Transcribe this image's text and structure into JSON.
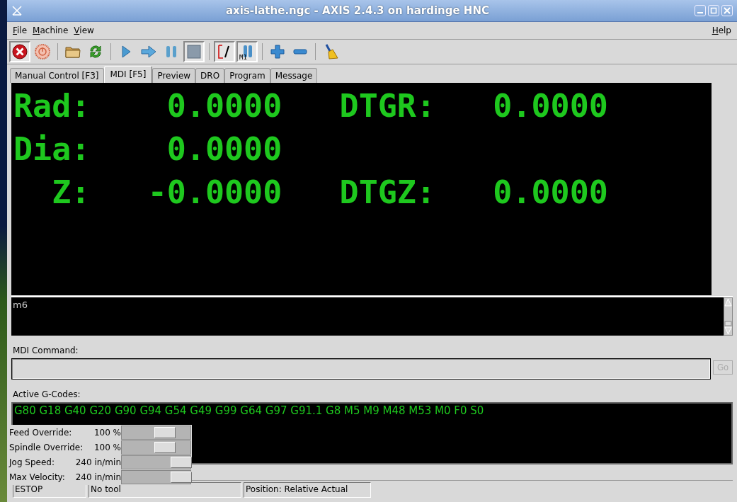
{
  "window": {
    "title": "axis-lathe.ngc - AXIS 2.4.3 on hardinge HNC"
  },
  "menu": {
    "left": [
      "File",
      "Machine",
      "View"
    ],
    "right": [
      "Help"
    ]
  },
  "toolbar": [
    [
      {
        "kind": "estop",
        "pressed": true
      },
      {
        "kind": "power",
        "pressed": false
      }
    ],
    [
      {
        "kind": "open",
        "pressed": false
      },
      {
        "kind": "reload",
        "pressed": false
      }
    ],
    [
      {
        "kind": "run",
        "pressed": false
      },
      {
        "kind": "step",
        "pressed": false
      },
      {
        "kind": "pause",
        "pressed": false
      },
      {
        "kind": "stop",
        "pressed": true
      }
    ],
    [
      {
        "kind": "block_delete",
        "pressed": true
      },
      {
        "kind": "optional_stop",
        "pressed": true,
        "label": "M1"
      }
    ],
    [
      {
        "kind": "zoom_in",
        "pressed": false
      },
      {
        "kind": "zoom_out",
        "pressed": false
      }
    ],
    [
      {
        "kind": "clear",
        "pressed": false
      }
    ]
  ],
  "tabs": [
    {
      "label": "Manual Control [F3]",
      "selected": false
    },
    {
      "label": "MDI [F5]",
      "selected": true
    },
    {
      "label": "Preview",
      "selected": false
    },
    {
      "label": "DRO",
      "selected": false
    },
    {
      "label": "Program",
      "selected": false
    },
    {
      "label": "Message",
      "selected": false
    }
  ],
  "dro": [
    {
      "label": "Rad:",
      "value": "0.0000",
      "dtg_label": "DTGR:",
      "dtg_value": "0.0000"
    },
    {
      "label": "Dia:",
      "value": "0.0000"
    },
    {
      "label": "Z:",
      "value": "-0.0000",
      "dtg_label": "DTGZ:",
      "dtg_value": "0.0000"
    }
  ],
  "mdi_history": [
    "m6"
  ],
  "mdi_command": {
    "label": "MDI Command:",
    "button": "Go",
    "button_disabled": true
  },
  "active_gcodes": {
    "label": "Active G-Codes:",
    "text": "G80 G18 G40 G20 G90 G94 G54 G49 G99 G64 G97 G91.1 G8 M5 M9 M48 M53 M0 F0 S0"
  },
  "overrides": [
    {
      "label": "Feed Override:",
      "reading": "100 %",
      "level": 0.66
    },
    {
      "label": "Spindle Override:",
      "reading": "100 %",
      "level": 0.66
    },
    {
      "label": "Jog Speed:",
      "reading": "240 in/min",
      "level": 1
    },
    {
      "label": "Max Velocity:",
      "reading": "240 in/min",
      "level": 1
    }
  ],
  "status_bar": [
    "ESTOP",
    "No tool",
    "Position: Relative Actual"
  ]
}
